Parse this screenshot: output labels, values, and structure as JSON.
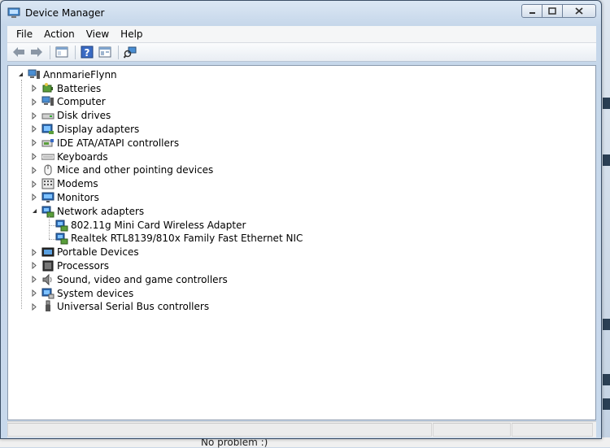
{
  "window": {
    "title": "Device Manager"
  },
  "menu": [
    {
      "label": "File"
    },
    {
      "label": "Action"
    },
    {
      "label": "View"
    },
    {
      "label": "Help"
    }
  ],
  "tree": {
    "root": "AnnmarieFlynn",
    "categories": [
      {
        "label": "Batteries",
        "icon": "battery-icon"
      },
      {
        "label": "Computer",
        "icon": "computer-icon"
      },
      {
        "label": "Disk drives",
        "icon": "disk-drive-icon"
      },
      {
        "label": "Display adapters",
        "icon": "display-adapter-icon"
      },
      {
        "label": "IDE ATA/ATAPI controllers",
        "icon": "ide-controller-icon"
      },
      {
        "label": "Keyboards",
        "icon": "keyboard-icon"
      },
      {
        "label": "Mice and other pointing devices",
        "icon": "mouse-icon"
      },
      {
        "label": "Modems",
        "icon": "modem-icon"
      },
      {
        "label": "Monitors",
        "icon": "monitor-icon"
      },
      {
        "label": "Network adapters",
        "icon": "network-adapter-icon",
        "expanded": true,
        "children": [
          {
            "label": "802.11g Mini Card Wireless Adapter",
            "icon": "network-adapter-icon"
          },
          {
            "label": "Realtek RTL8139/810x Family Fast Ethernet NIC",
            "icon": "network-adapter-icon"
          }
        ]
      },
      {
        "label": "Portable Devices",
        "icon": "portable-device-icon"
      },
      {
        "label": "Processors",
        "icon": "processor-icon"
      },
      {
        "label": "Sound, video and game controllers",
        "icon": "sound-icon"
      },
      {
        "label": "System devices",
        "icon": "system-devices-icon"
      },
      {
        "label": "Universal Serial Bus controllers",
        "icon": "usb-icon"
      }
    ]
  },
  "background": {
    "bottom_text": "No problem :)"
  }
}
